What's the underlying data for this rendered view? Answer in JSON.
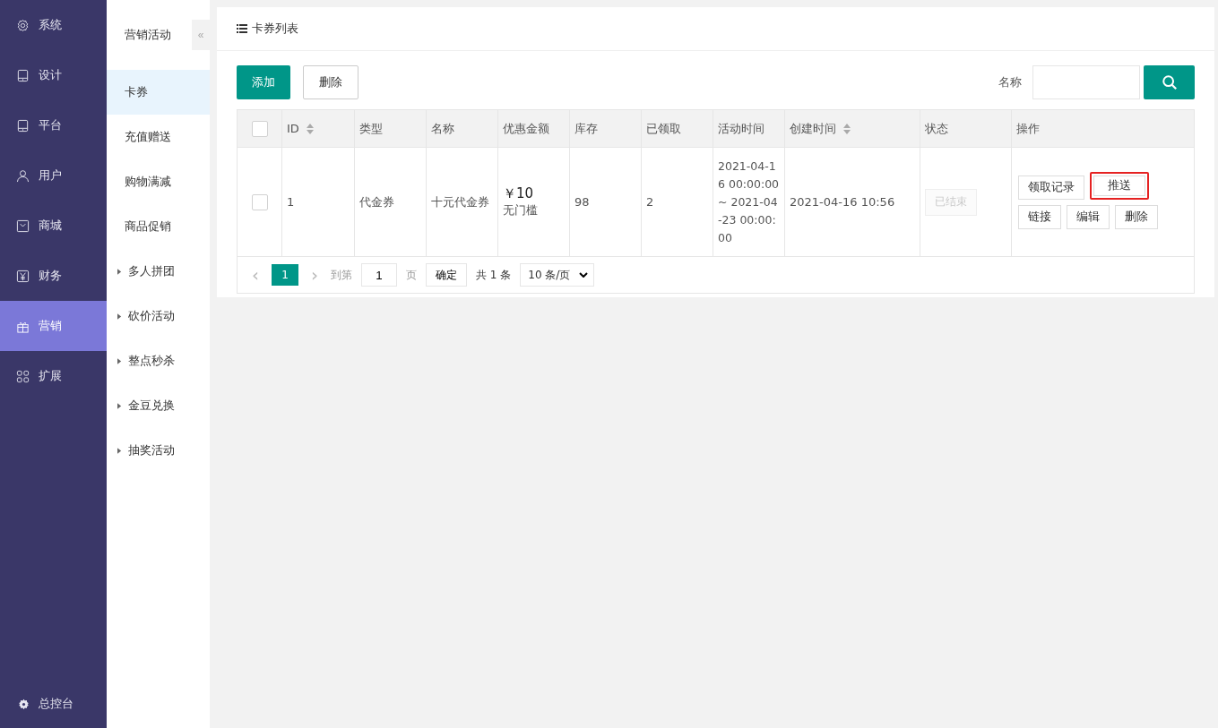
{
  "sidebar": {
    "items": [
      {
        "label": "系统",
        "kind": "gear",
        "selected": false
      },
      {
        "label": "设计",
        "kind": "tablet",
        "selected": false
      },
      {
        "label": "平台",
        "kind": "tablet",
        "selected": false
      },
      {
        "label": "用户",
        "kind": "user",
        "selected": false
      },
      {
        "label": "商城",
        "kind": "bag",
        "selected": false
      },
      {
        "label": "财务",
        "kind": "yen",
        "selected": false
      },
      {
        "label": "营销",
        "kind": "gift",
        "selected": true
      },
      {
        "label": "扩展",
        "kind": "grid",
        "selected": false
      }
    ],
    "footer": {
      "label": "总控台",
      "kind": "gear"
    }
  },
  "subnav": {
    "title": "营销活动",
    "collapse": "«",
    "items": [
      {
        "label": "卡券",
        "selected": true,
        "expandable": false
      },
      {
        "label": "充值赠送",
        "selected": false,
        "expandable": false
      },
      {
        "label": "购物满减",
        "selected": false,
        "expandable": false
      },
      {
        "label": "商品促销",
        "selected": false,
        "expandable": false
      },
      {
        "label": "多人拼团",
        "selected": false,
        "expandable": true
      },
      {
        "label": "砍价活动",
        "selected": false,
        "expandable": true
      },
      {
        "label": "整点秒杀",
        "selected": false,
        "expandable": true
      },
      {
        "label": "金豆兑换",
        "selected": false,
        "expandable": true
      },
      {
        "label": "抽奖活动",
        "selected": false,
        "expandable": true
      }
    ]
  },
  "panel": {
    "title": "卡券列表",
    "toolbar": {
      "add": "添加",
      "delete": "删除",
      "search_label": "名称"
    },
    "table": {
      "select_all_checked": false,
      "columns": [
        {
          "label": "ID",
          "sortable": true
        },
        {
          "label": "类型",
          "sortable": false
        },
        {
          "label": "名称",
          "sortable": false
        },
        {
          "label": "优惠金额",
          "sortable": false
        },
        {
          "label": "库存",
          "sortable": false
        },
        {
          "label": "已领取",
          "sortable": false
        },
        {
          "label": "活动时间",
          "sortable": false
        },
        {
          "label": "创建时间",
          "sortable": true
        },
        {
          "label": "状态",
          "sortable": false
        },
        {
          "label": "操作",
          "sortable": false
        }
      ],
      "rows": [
        {
          "checked": false,
          "id": "1",
          "type": "代金券",
          "name": "十元代金券",
          "amount": "￥10",
          "threshold": "无门槛",
          "stock": "98",
          "claimed": "2",
          "period": "2021-04-16 00:00:00 ~ 2021-04-23 00:00:00",
          "created": "2021-04-16 10:56",
          "status": "已结束",
          "status_disabled": true,
          "actions": [
            {
              "label": "领取记录",
              "highlighted": false
            },
            {
              "label": "推送",
              "highlighted": true
            },
            {
              "label": "链接",
              "highlighted": false
            },
            {
              "label": "编辑",
              "highlighted": false
            },
            {
              "label": "删除",
              "highlighted": false
            }
          ]
        }
      ]
    },
    "pager": {
      "prev": "‹",
      "page": "1",
      "next": "›",
      "goto": "到第",
      "page_input": "1",
      "page_unit": "页",
      "confirm": "确定",
      "total": "共 1 条",
      "page_size": "10 条/页"
    }
  }
}
